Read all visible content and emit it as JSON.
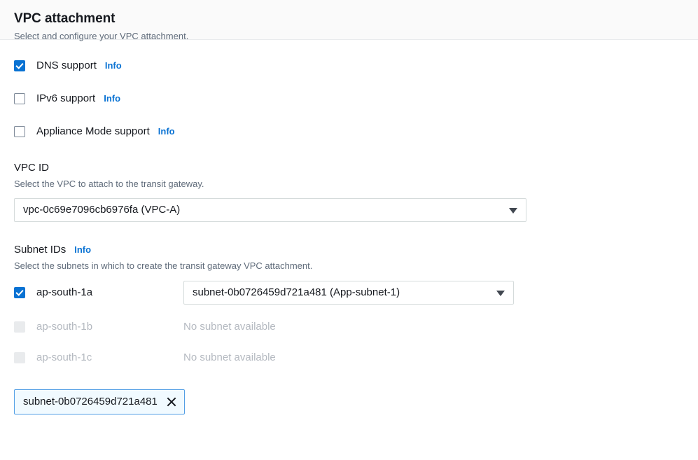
{
  "header": {
    "title": "VPC attachment",
    "subtitle": "Select and configure your VPC attachment."
  },
  "options": [
    {
      "label": "DNS support",
      "info": "Info",
      "checked": true,
      "disabled": false
    },
    {
      "label": "IPv6 support",
      "info": "Info",
      "checked": false,
      "disabled": false
    },
    {
      "label": "Appliance Mode support",
      "info": "Info",
      "checked": false,
      "disabled": false
    }
  ],
  "vpc_id": {
    "label": "VPC ID",
    "description": "Select the VPC to attach to the transit gateway.",
    "selected": "vpc-0c69e7096cb6976fa (VPC-A)",
    "caret_icon": "chevron-down-icon"
  },
  "subnet_ids": {
    "label": "Subnet IDs",
    "info": "Info",
    "description": "Select the subnets in which to create the transit gateway VPC attachment.",
    "rows": [
      {
        "az": "ap-south-1a",
        "checked": true,
        "disabled": false,
        "selected": "subnet-0b0726459d721a481 (App-subnet-1)",
        "caret_icon": "chevron-down-icon"
      },
      {
        "az": "ap-south-1b",
        "checked": false,
        "disabled": true,
        "empty_text": "No subnet available"
      },
      {
        "az": "ap-south-1c",
        "checked": false,
        "disabled": true,
        "empty_text": "No subnet available"
      }
    ]
  },
  "tokens": [
    {
      "label": "subnet-0b0726459d721a481",
      "dismiss_icon": "close-icon"
    }
  ],
  "colors": {
    "accent": "#0972d3",
    "token_border": "#539fe5",
    "token_bg": "#f1faff",
    "muted_text": "#5f6b7a",
    "disabled_text": "#b4b9c0",
    "header_bg": "#fafafa",
    "border": "#d5dbdb"
  }
}
